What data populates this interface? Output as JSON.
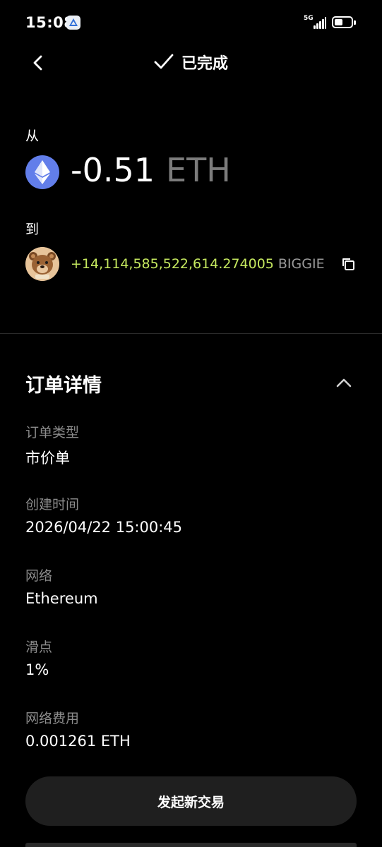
{
  "status_bar": {
    "time": "15:08",
    "network": "5G",
    "battery_level": 0.5
  },
  "header": {
    "title": "已完成"
  },
  "from": {
    "label": "从",
    "amount": "-0.51",
    "symbol": "ETH",
    "icon": "ethereum-icon",
    "icon_color": "#627eea"
  },
  "to": {
    "label": "到",
    "amount": "+14,114,585,522,614.274005",
    "symbol": "BIGGIE",
    "amount_color": "#c5e85f",
    "icon": "bear-token-icon"
  },
  "order_details": {
    "title": "订单详情",
    "rows": [
      {
        "label": "订单类型",
        "value": "市价单"
      },
      {
        "label": "创建时间",
        "value": "2026/04/22 15:00:45"
      },
      {
        "label": "网络",
        "value": "Ethereum"
      },
      {
        "label": "滑点",
        "value": "1%"
      },
      {
        "label": "网络费用",
        "value": "0.001261 ETH"
      }
    ]
  },
  "cta": {
    "label": "发起新交易"
  }
}
